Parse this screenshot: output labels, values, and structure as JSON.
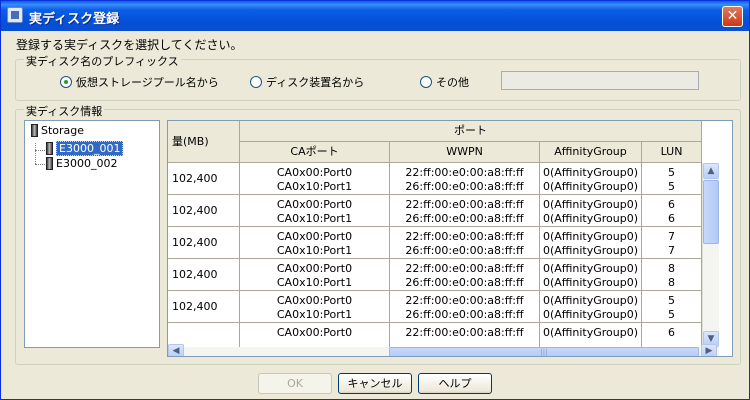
{
  "window": {
    "title": "実ディスク登録",
    "close_label": "✕"
  },
  "instruction": "登録する実ディスクを選択してください。",
  "prefix_group": {
    "legend": "実ディスク名のプレフィックス",
    "options": [
      "仮想ストレージプール名から",
      "ディスク装置名から",
      "その他"
    ],
    "selected_index": 0,
    "other_value": ""
  },
  "info_group": {
    "legend": "実ディスク情報",
    "tree": {
      "root": "Storage",
      "children": [
        "E3000_001",
        "E3000_002"
      ],
      "selected": "E3000_001"
    },
    "table": {
      "col_capacity": "量(MB)",
      "col_port": "ポート",
      "col_ca_port": "CAポート",
      "col_wwpn": "WWPN",
      "col_affinity": "AffinityGroup",
      "col_lun": "LUN",
      "rows": [
        {
          "cap": "102,400",
          "ca1": "CA0x00:Port0",
          "ca2": "CA0x10:Port1",
          "w1": "22:ff:00:e0:00:a8:ff:ff",
          "w2": "26:ff:00:e0:00:a8:ff:ff",
          "a1": "0(AffinityGroup0)",
          "a2": "0(AffinityGroup0)",
          "l1": "5",
          "l2": "5"
        },
        {
          "cap": "102,400",
          "ca1": "CA0x00:Port0",
          "ca2": "CA0x10:Port1",
          "w1": "22:ff:00:e0:00:a8:ff:ff",
          "w2": "26:ff:00:e0:00:a8:ff:ff",
          "a1": "0(AffinityGroup0)",
          "a2": "0(AffinityGroup0)",
          "l1": "6",
          "l2": "6"
        },
        {
          "cap": "102,400",
          "ca1": "CA0x00:Port0",
          "ca2": "CA0x10:Port1",
          "w1": "22:ff:00:e0:00:a8:ff:ff",
          "w2": "26:ff:00:e0:00:a8:ff:ff",
          "a1": "0(AffinityGroup0)",
          "a2": "0(AffinityGroup0)",
          "l1": "7",
          "l2": "7"
        },
        {
          "cap": "102,400",
          "ca1": "CA0x00:Port0",
          "ca2": "CA0x10:Port1",
          "w1": "22:ff:00:e0:00:a8:ff:ff",
          "w2": "26:ff:00:e0:00:a8:ff:ff",
          "a1": "0(AffinityGroup0)",
          "a2": "0(AffinityGroup0)",
          "l1": "8",
          "l2": "8"
        },
        {
          "cap": "102,400",
          "ca1": "CA0x00:Port0",
          "ca2": "CA0x10:Port1",
          "w1": "22:ff:00:e0:00:a8:ff:ff",
          "w2": "26:ff:00:e0:00:a8:ff:ff",
          "a1": "0(AffinityGroup0)",
          "a2": "0(AffinityGroup0)",
          "l1": "5",
          "l2": "5"
        },
        {
          "cap": "",
          "ca1": "CA0x00:Port0",
          "ca2": "",
          "w1": "22:ff:00:e0:00:a8:ff:ff",
          "w2": "",
          "a1": "0(AffinityGroup0)",
          "a2": "",
          "l1": "6",
          "l2": ""
        }
      ]
    }
  },
  "buttons": {
    "ok": "OK",
    "cancel": "キャンセル",
    "help": "ヘルプ"
  },
  "icons": {
    "close": "close-icon",
    "disk": "disk-icon",
    "scroll_up": "arrow-up-icon",
    "scroll_down": "arrow-down-icon",
    "scroll_left": "arrow-left-icon",
    "scroll_right": "arrow-right-icon"
  },
  "colors": {
    "title_bar": "#0a5ee8",
    "selection": "#316ac5",
    "dialog_bg": "#ece9d8"
  }
}
